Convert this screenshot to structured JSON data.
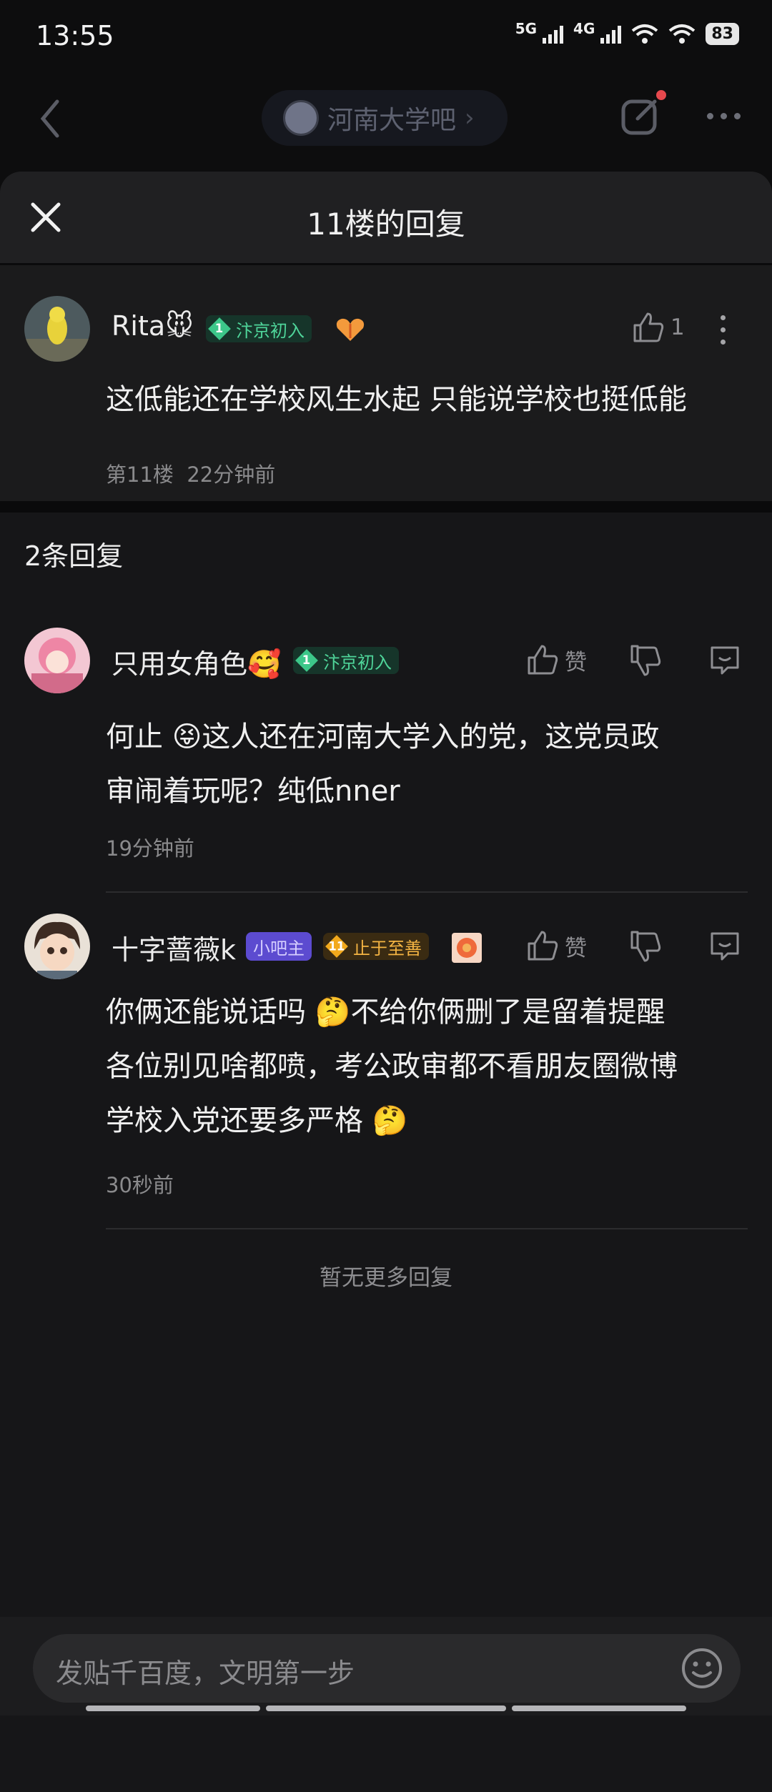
{
  "status_bar": {
    "time": "13:55",
    "net1": "5G",
    "net2": "4G",
    "battery": "83"
  },
  "nav": {
    "bar_name": "河南大学吧",
    "chevron": "›"
  },
  "sheet": {
    "title": "11楼的回复"
  },
  "main_post": {
    "username": "Rita🐭",
    "level_num": "1",
    "level_label": "汴京初入",
    "like_count": "1",
    "content": "这低能还在学校风生水起 只能说学校也挺低能",
    "floor": "第11楼",
    "time": "22分钟前"
  },
  "replies_count": "2条回复",
  "replies": [
    {
      "username": "只用女角色🥰",
      "level_num": "1",
      "level_label": "汴京初入",
      "like_label": "赞",
      "content_line1": "何止 😝这人还在河南大学入的党，这党员政",
      "content_line2": "审闹着玩呢？纯低nner",
      "time": "19分钟前"
    },
    {
      "username": "十字蔷薇k",
      "mod_label": "小吧主",
      "level_num": "11",
      "level_label": "止于至善",
      "like_label": "赞",
      "content_line1": "你俩还能说话吗 🤔不给你俩删了是留着提醒",
      "content_line2": "各位别见啥都喷，考公政审都不看朋友圈微博",
      "content_line3": "学校入党还要多严格 🤔",
      "time": "30秒前"
    }
  ],
  "no_more": "暂无更多回复",
  "input": {
    "placeholder": "发贴千百度，文明第一步"
  }
}
